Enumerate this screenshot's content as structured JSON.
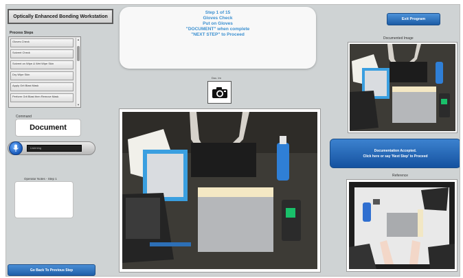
{
  "app": {
    "title": "Optically Enhanced Bonding Workstation"
  },
  "process_steps": {
    "label": "Process Steps",
    "items": [
      "Gloves Check",
      "Solvent Check",
      "Solvent on Wipe & Wet Wipe Skin",
      "Dry Wipe Skin",
      "Apply Grit Blast Mask",
      "Perform Grit Blast then Remove Mask"
    ]
  },
  "command": {
    "label": "Command",
    "value": "Document"
  },
  "voice": {
    "status": "Listening",
    "mic_icon": "microphone-icon"
  },
  "operator_notes": {
    "label": "Operator Notes - Step 1"
  },
  "instructions": {
    "lines": [
      "Step 1 of 15",
      "Gloves Check",
      "Put on Gloves",
      "\"DOCUMENT\" when complete",
      "",
      "\"NEXT STEP\" to Proceed"
    ],
    "color": "#3a8fd0"
  },
  "camera": {
    "label": "Doc. Im",
    "icon": "camera-icon"
  },
  "buttons": {
    "exit": "Exit Program",
    "back": "Go Back To Previous Step",
    "accepted_line1": "Documentation Accepted.",
    "accepted_line2": "Click here or say 'Next Step' to Proceed"
  },
  "documented_image": {
    "label": "Documented Image"
  },
  "reference": {
    "label": "Reference"
  },
  "colors": {
    "accent_blue": "#1f5fa8",
    "panel_gray": "#cfd3d4"
  }
}
